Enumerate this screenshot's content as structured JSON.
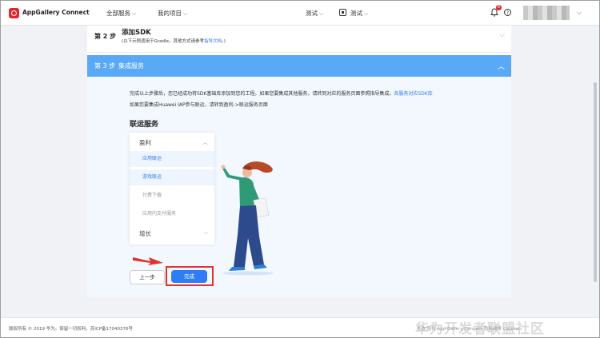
{
  "header": {
    "brand": "AppGallery Connect",
    "nav_all_services": "全部服务",
    "nav_my_projects": "我的项目",
    "test1": "测试",
    "test2": "测试",
    "notification_count": "8",
    "help_glyph": "?"
  },
  "step2": {
    "num": "第 2 步",
    "title": "添加SDK",
    "sub_prefix": "(以下示例适用于Gradle。其他方式请参考",
    "sub_link": "指导文档",
    "sub_suffix": "。)"
  },
  "step3": {
    "num": "第 3 步",
    "title": "集成服务",
    "desc1": "完成以上步骤后，您已经成功将SDK基础库添加到您的工程。如果您要集成其他服务，请转到对应的服务页面参照指导集成。",
    "desc1_link": "各服务对应SDK库",
    "desc2": "如果您要集成Huawei IAP参与联运，请转到盈利->联运服务页面",
    "section_title": "联运服务",
    "menu": {
      "group1": "盈利",
      "items": [
        "应用联运",
        "游戏联运",
        "付费下载",
        "应用内支付服务"
      ],
      "group2": "增长"
    },
    "prev_button": "上一步",
    "done_button": "完成"
  },
  "footer": {
    "copyright": "版权所有 © 2019 华为。保留一切权利。苏ICP备17040376号",
    "links": "条款  隐私  App Gallery Connect  隐私政策  cookies",
    "watermark": "华为开发者联盟社区"
  },
  "colors": {
    "accent": "#2e7cf6",
    "step_header": "#5aa9f7",
    "highlight_red": "#e3322b"
  }
}
